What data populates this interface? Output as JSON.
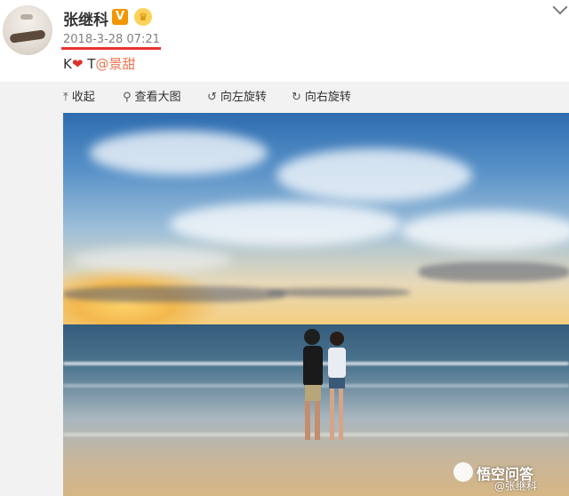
{
  "post": {
    "username": "张继科",
    "verified_badge": "V",
    "timestamp": "2018-3-28 07:21",
    "text_prefix": "K",
    "heart": "❤",
    "text_mid": " T",
    "mention": "@景甜"
  },
  "toolbar": {
    "collapse": "收起",
    "view_large": "查看大图",
    "rotate_left": "向左旋转",
    "rotate_right": "向右旋转"
  },
  "watermark": {
    "brand": "悟空问答",
    "user": "@张继科"
  },
  "colors": {
    "mention": "#eb7350",
    "underline": "#e8342f",
    "verified": "#f29600"
  }
}
